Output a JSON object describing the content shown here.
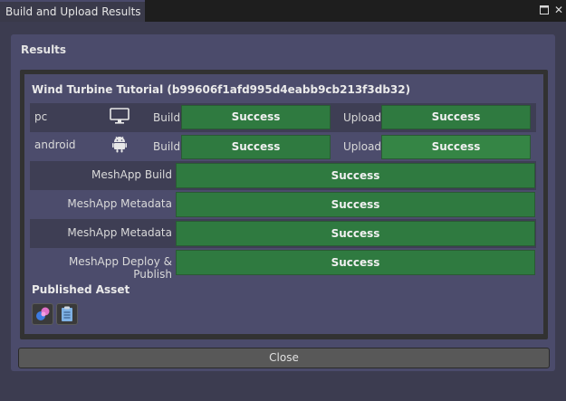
{
  "window": {
    "title": "Build and Upload Results"
  },
  "results": {
    "title": "Results",
    "project_title": "Wind Turbine Tutorial (b99606f1afd995d4eabb9cb213f3db32)",
    "platforms": [
      {
        "name": "pc",
        "icon": "monitor-icon",
        "build_label": "Build",
        "build_status": "Success",
        "upload_label": "Upload",
        "upload_status": "Success"
      },
      {
        "name": "android",
        "icon": "android-icon",
        "build_label": "Build",
        "build_status": "Success",
        "upload_label": "Upload",
        "upload_status": "Success"
      }
    ],
    "steps": [
      {
        "label": "MeshApp Build",
        "status": "Success"
      },
      {
        "label": "MeshApp Metadata",
        "status": "Success"
      },
      {
        "label": "MeshApp Metadata",
        "status": "Success"
      },
      {
        "label": "MeshApp Deploy & Publish",
        "status": "Success"
      }
    ],
    "published_title": "Published Asset",
    "asset_buttons": [
      "mesh-asset-icon",
      "clipboard-icon"
    ]
  },
  "footer": {
    "close_label": "Close"
  },
  "colors": {
    "success": "#2f7a40",
    "panel": "#4c4c6c",
    "background": "#3c3c50"
  }
}
